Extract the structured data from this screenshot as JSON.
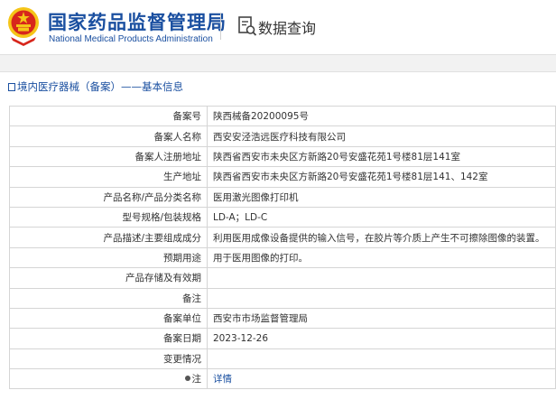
{
  "header": {
    "org_name_cn": "国家药品监督管理局",
    "org_name_en": "National Medical Products Administration",
    "query_title": "数据查询",
    "emblem_icon": "national-emblem-icon",
    "query_icon": "document-search-icon"
  },
  "breadcrumb": "境内医疗器械（备案）——基本信息",
  "colors": {
    "brand_blue": "#1a4fa0",
    "emblem_red": "#d7261c",
    "emblem_gold": "#f5c518"
  },
  "rows": [
    {
      "label": "备案号",
      "value": "陕西械备20200095号"
    },
    {
      "label": "备案人名称",
      "value": "西安安泾浩远医疗科技有限公司"
    },
    {
      "label": "备案人注册地址",
      "value": "陕西省西安市未央区方新路20号安盛花苑1号楼81层141室"
    },
    {
      "label": "生产地址",
      "value": "陕西省西安市未央区方新路20号安盛花苑1号楼81层141、142室"
    },
    {
      "label": "产品名称/产品分类名称",
      "value": "医用激光图像打印机"
    },
    {
      "label": "型号规格/包装规格",
      "value": "LD-A；LD-C"
    },
    {
      "label": "产品描述/主要组成成分",
      "value": "利用医用成像设备提供的输入信号，在胶片等介质上产生不可擦除图像的装置。"
    },
    {
      "label": "预期用途",
      "value": "用于医用图像的打印。"
    },
    {
      "label": "产品存储及有效期",
      "value": ""
    },
    {
      "label": "备注",
      "value": ""
    },
    {
      "label": "备案单位",
      "value": "西安市市场监督管理局"
    },
    {
      "label": "备案日期",
      "value": "2023-12-26"
    },
    {
      "label": "变更情况",
      "value": ""
    },
    {
      "label": "注",
      "value": "详情"
    }
  ]
}
